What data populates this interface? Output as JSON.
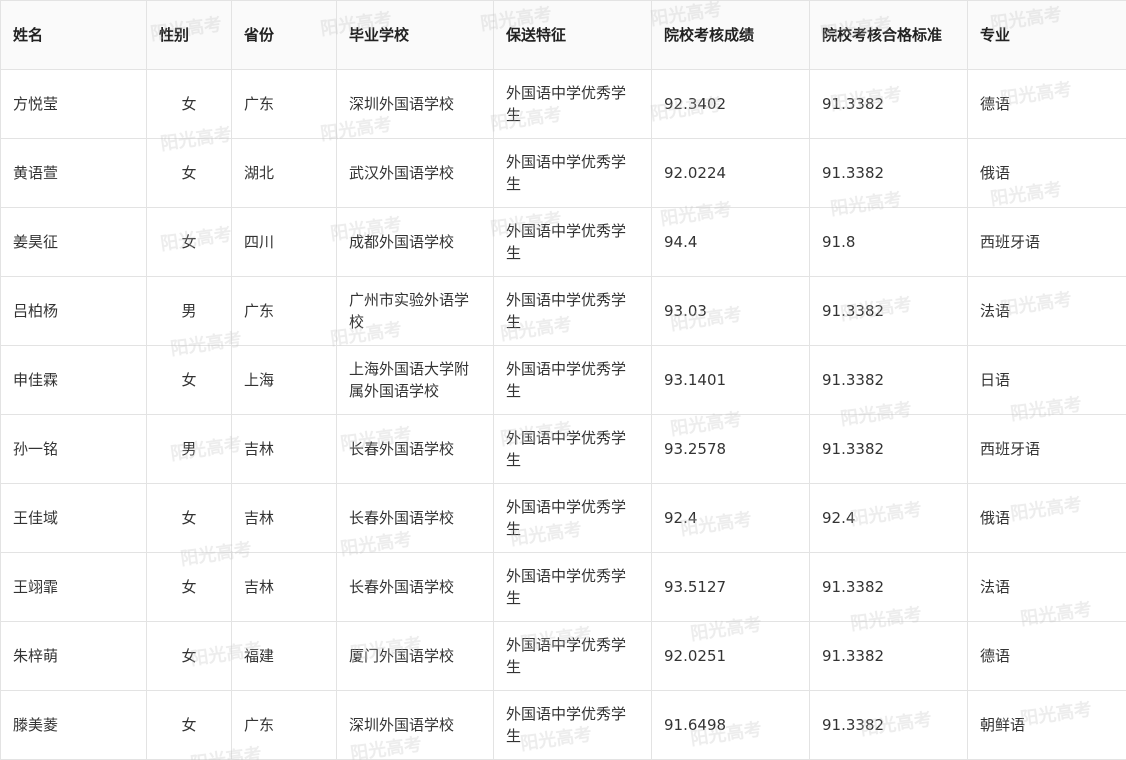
{
  "table": {
    "headers": [
      "姓名",
      "性别",
      "省份",
      "毕业学校",
      "保送特征",
      "院校考核成绩",
      "院校考核合格标准",
      "专业"
    ],
    "rows": [
      [
        "方悦莹",
        "女",
        "广东",
        "深圳外国语学校",
        "外国语中学优秀学生",
        "92.3402",
        "91.3382",
        "德语"
      ],
      [
        "黄语萱",
        "女",
        "湖北",
        "武汉外国语学校",
        "外国语中学优秀学生",
        "92.0224",
        "91.3382",
        "俄语"
      ],
      [
        "姜昊征",
        "女",
        "四川",
        "成都外国语学校",
        "外国语中学优秀学生",
        "94.4",
        "91.8",
        "西班牙语"
      ],
      [
        "吕柏杨",
        "男",
        "广东",
        "广州市实验外语学校",
        "外国语中学优秀学生",
        "93.03",
        "91.3382",
        "法语"
      ],
      [
        "申佳霖",
        "女",
        "上海",
        "上海外国语大学附属外国语学校",
        "外国语中学优秀学生",
        "93.1401",
        "91.3382",
        "日语"
      ],
      [
        "孙一铭",
        "男",
        "吉林",
        "长春外国语学校",
        "外国语中学优秀学生",
        "93.2578",
        "91.3382",
        "西班牙语"
      ],
      [
        "王佳域",
        "女",
        "吉林",
        "长春外国语学校",
        "外国语中学优秀学生",
        "92.4",
        "92.4",
        "俄语"
      ],
      [
        "王翊霏",
        "女",
        "吉林",
        "长春外国语学校",
        "外国语中学优秀学生",
        "93.5127",
        "91.3382",
        "法语"
      ],
      [
        "朱梓萌",
        "女",
        "福建",
        "厦门外国语学校",
        "外国语中学优秀学生",
        "92.0251",
        "91.3382",
        "德语"
      ],
      [
        "滕美菱",
        "女",
        "广东",
        "深圳外国语学校",
        "外国语中学优秀学生",
        "91.6498",
        "91.3382",
        "朝鲜语"
      ]
    ]
  },
  "watermark": {
    "text": "阳光高考",
    "color": "#bebebe"
  }
}
